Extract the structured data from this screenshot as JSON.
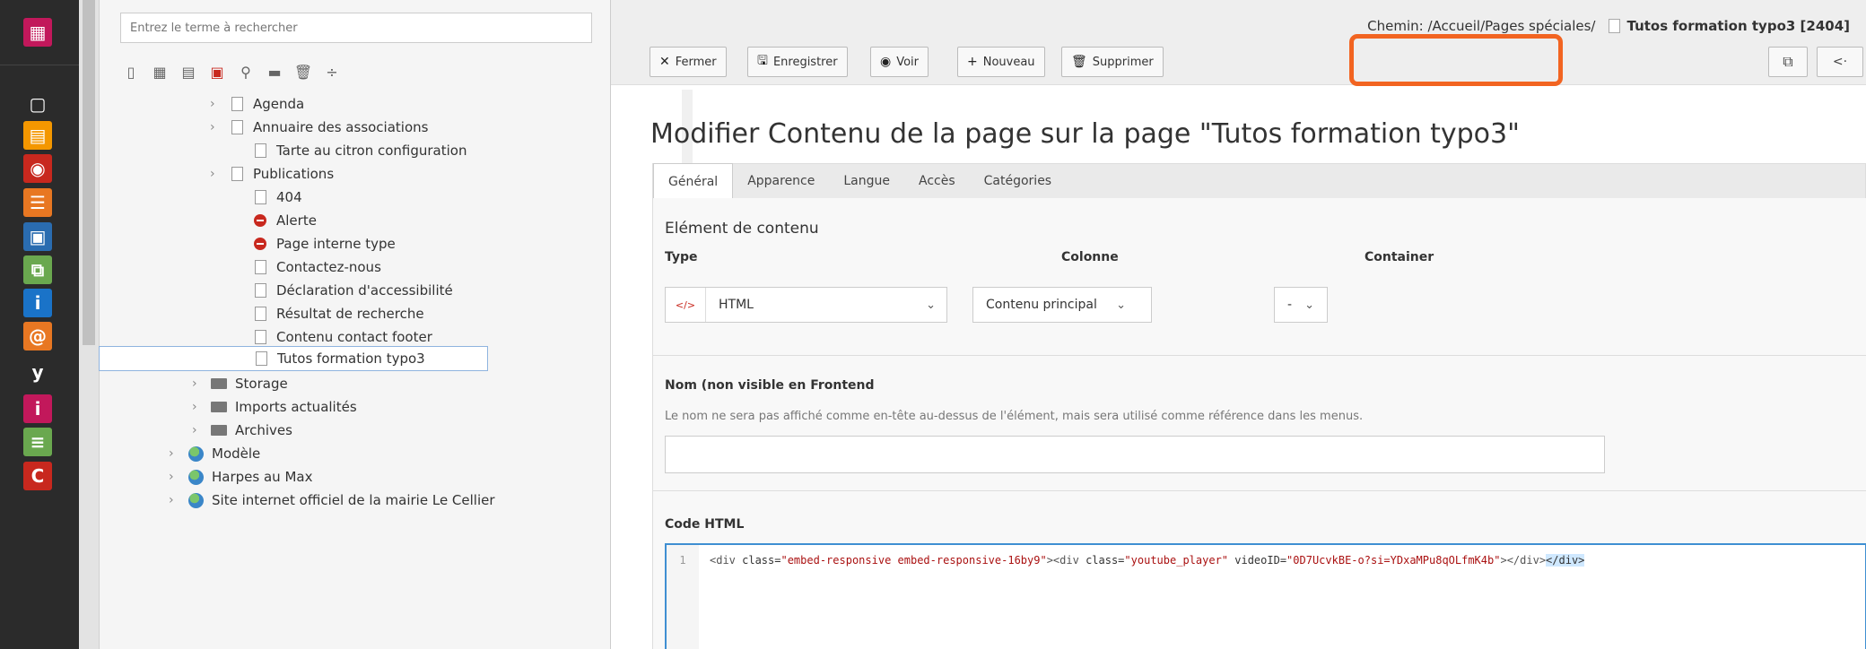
{
  "modules": [
    {
      "name": "layout-module",
      "color": "#c2185b",
      "glyph": "▦"
    },
    {
      "name": "page-module",
      "color": "#5a5a5a",
      "glyph": "▢"
    },
    {
      "name": "page-active-module",
      "color": "#f49700",
      "glyph": "▤"
    },
    {
      "name": "view-module",
      "color": "#c8281e",
      "glyph": "◉"
    },
    {
      "name": "list-module",
      "color": "#e87722",
      "glyph": "☰"
    },
    {
      "name": "form-module",
      "color": "#2a6cb0",
      "glyph": "▣"
    },
    {
      "name": "workspaces-module",
      "color": "#6aa84f",
      "glyph": "⧉"
    },
    {
      "name": "info-module",
      "color": "#1a73c8",
      "glyph": "i"
    },
    {
      "name": "at-module",
      "color": "#e87722",
      "glyph": "@"
    },
    {
      "name": "yoast-module",
      "color": "#2b2b2b",
      "glyph": "y"
    },
    {
      "name": "info2-module",
      "color": "#c2185b",
      "glyph": "i"
    },
    {
      "name": "menu-module",
      "color": "#6aa84f",
      "glyph": "≡"
    },
    {
      "name": "c-module",
      "color": "#c8281e",
      "glyph": "C"
    }
  ],
  "tree": {
    "search_placeholder": "Entrez le terme à rechercher",
    "collapse_glyph": "‹",
    "more_glyph": "⋮",
    "nodes": [
      {
        "label": "Agenda",
        "chev": "›",
        "icon": "doc"
      },
      {
        "label": "Annuaire des associations",
        "chev": "›",
        "icon": "doc"
      },
      {
        "label": "Tarte au citron configuration",
        "chev": "",
        "icon": "doc"
      },
      {
        "label": "Publications",
        "chev": "›",
        "icon": "doc"
      },
      {
        "label": "404",
        "chev": "",
        "icon": "doc"
      },
      {
        "label": "Alerte",
        "chev": "",
        "icon": "red"
      },
      {
        "label": "Page interne type",
        "chev": "",
        "icon": "red"
      },
      {
        "label": "Contactez-nous",
        "chev": "",
        "icon": "doc"
      },
      {
        "label": "Déclaration d'accessibilité",
        "chev": "",
        "icon": "doc"
      },
      {
        "label": "Résultat de recherche",
        "chev": "",
        "icon": "doc"
      },
      {
        "label": "Contenu contact footer",
        "chev": "",
        "icon": "doc"
      },
      {
        "label": "Tutos formation typo3",
        "chev": "",
        "icon": "doc"
      },
      {
        "label": "Storage",
        "chev": "›",
        "icon": "folder"
      },
      {
        "label": "Imports actualités",
        "chev": "›",
        "icon": "folder"
      },
      {
        "label": "Archives",
        "chev": "›",
        "icon": "folder"
      },
      {
        "label": "Modèle",
        "chev": "›",
        "icon": "globe"
      },
      {
        "label": "Harpes au Max",
        "chev": "›",
        "icon": "globe"
      },
      {
        "label": "Site internet officiel de la mairie Le Cellier",
        "chev": "›",
        "icon": "globe"
      }
    ]
  },
  "breadcrumb": {
    "prefix": "Chemin: /Accueil/Pages spéciales/",
    "current": "Tutos formation typo3 [2404]"
  },
  "toolbar": {
    "close": "Fermer",
    "save": "Enregistrer",
    "view": "Voir",
    "new": "Nouveau",
    "delete": "Supprimer",
    "highlight_color": "#f26421"
  },
  "page_title": "Modifier Contenu de la page sur la page \"Tutos formation typo3\"",
  "tabs": [
    "Général",
    "Apparence",
    "Langue",
    "Accès",
    "Catégories"
  ],
  "form": {
    "section": "Elément de contenu",
    "type_label": "Type",
    "type_value": "HTML",
    "column_label": "Colonne",
    "column_value": "Contenu principal",
    "container_label": "Container",
    "container_value": "-",
    "name_label": "Nom (non visible en Frontend",
    "name_help": "Le nom ne sera pas affiché comme en-tête au-dessus de l'élément, mais sera utilisé comme référence dans les menus.",
    "name_value": "",
    "code_label": "Code HTML",
    "code_line_number": "1",
    "code_tokens": [
      {
        "cls": "tag",
        "text": "<div "
      },
      {
        "cls": "attr",
        "text": "class="
      },
      {
        "cls": "str",
        "text": "\"embed-responsive embed-responsive-16by9\""
      },
      {
        "cls": "tag",
        "text": "><div "
      },
      {
        "cls": "attr",
        "text": "class="
      },
      {
        "cls": "str",
        "text": "\"youtube_player\""
      },
      {
        "cls": "attr",
        "text": " videoID="
      },
      {
        "cls": "str",
        "text": "\"0D7UcvkBE-o?si=YDxaMPu8qOLfmK4b\""
      },
      {
        "cls": "tag",
        "text": "></div>"
      },
      {
        "cls": "cursor",
        "text": "</div>"
      }
    ]
  }
}
